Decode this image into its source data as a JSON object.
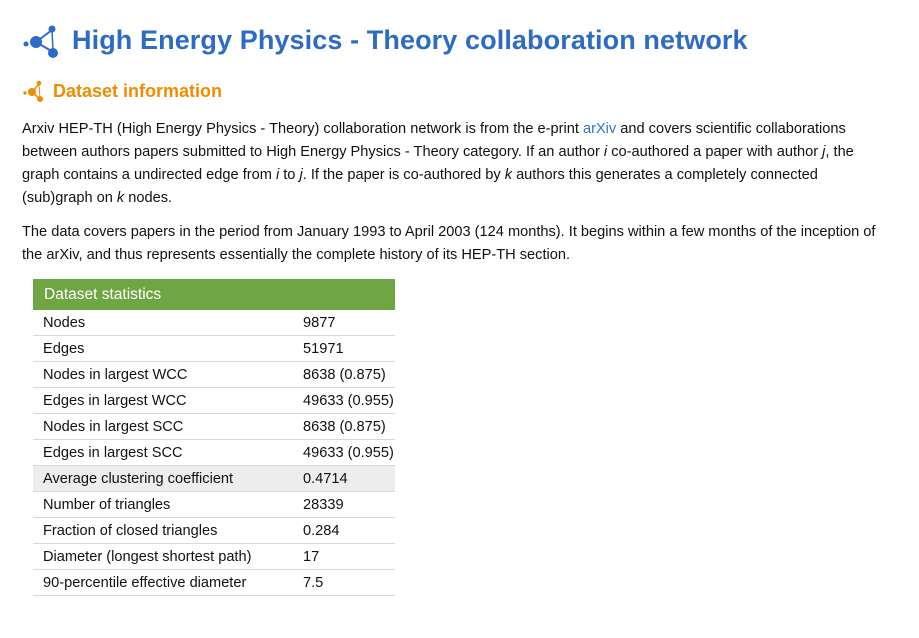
{
  "header": {
    "title": "High Energy Physics - Theory collaboration network"
  },
  "section": {
    "title": "Dataset information"
  },
  "description": {
    "p1": {
      "intro": "Arxiv HEP-TH (High Energy Physics - Theory) collaboration network is from the e-print ",
      "link": "arXiv",
      "a": " and covers scientific collaborations between authors papers submitted to High Energy Physics - Theory category. If an author ",
      "var_i": "i",
      "b": " co-authored a paper with author ",
      "var_j": "j",
      "c": ", the graph contains a undirected edge from ",
      "var_i2": "i",
      "d": " to ",
      "var_j2": "j",
      "e": ". If the paper is co-authored by ",
      "var_k": "k",
      "f": " authors this generates a completely connected (sub)graph on ",
      "var_k2": "k",
      "g": " nodes."
    },
    "p2": "The data covers papers in the period from January 1993 to April 2003 (124 months). It begins within a few months of the inception of the arXiv, and thus represents essentially the complete history of its HEP-TH section."
  },
  "stats": {
    "header": "Dataset statistics",
    "rows": [
      {
        "label": "Nodes",
        "value": "9877"
      },
      {
        "label": "Edges",
        "value": "51971"
      },
      {
        "label": "Nodes in largest WCC",
        "value": "8638 (0.875)"
      },
      {
        "label": "Edges in largest WCC",
        "value": "49633 (0.955)"
      },
      {
        "label": "Nodes in largest SCC",
        "value": "8638 (0.875)"
      },
      {
        "label": "Edges in largest SCC",
        "value": "49633 (0.955)"
      },
      {
        "label": "Average clustering coefficient",
        "value": "0.4714"
      },
      {
        "label": "Number of triangles",
        "value": "28339"
      },
      {
        "label": "Fraction of closed triangles",
        "value": "0.284"
      },
      {
        "label": "Diameter (longest shortest path)",
        "value": "17"
      },
      {
        "label": "90-percentile effective diameter",
        "value": "7.5"
      }
    ]
  },
  "colors": {
    "title": "#2d6bc4",
    "section": "#f08c00",
    "link": "#2f73c7",
    "table_header": "#6fa643",
    "row_highlight": "#ededed"
  },
  "icons": {
    "title": "network-icon",
    "section": "network-icon-small"
  }
}
